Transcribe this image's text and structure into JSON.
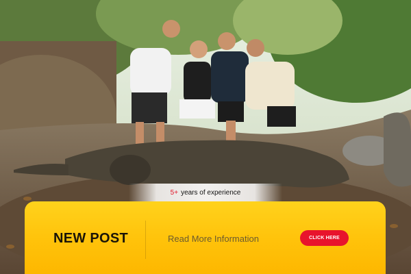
{
  "experience": {
    "highlight": "5+",
    "text": "years of experience"
  },
  "banner": {
    "title": "NEW POST",
    "link_text": "Read More Information",
    "cta_label": "CLICK HERE"
  },
  "colors": {
    "banner_yellow": "#ffc20a",
    "cta_red": "#e8132c",
    "highlight_red": "#e21a2c"
  }
}
